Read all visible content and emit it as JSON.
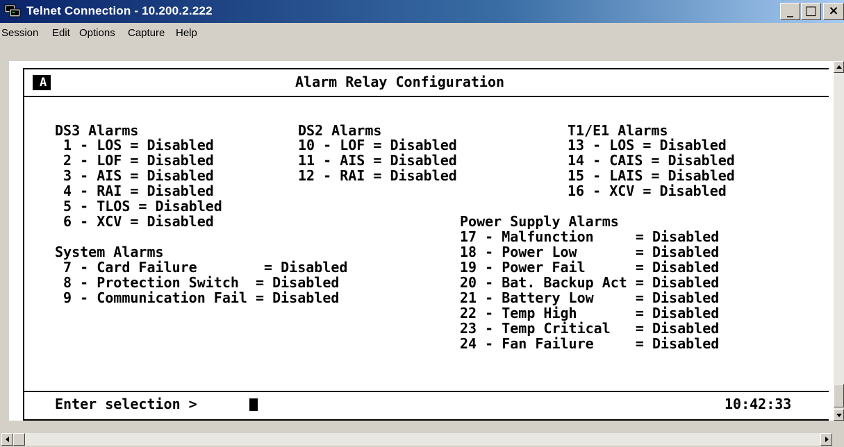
{
  "window": {
    "title": "Telnet Connection - 10.200.2.222",
    "minimize_glyph": "_",
    "maximize_glyph": "□",
    "close_glyph": "×"
  },
  "menu": {
    "items": [
      "Session",
      "Edit",
      "Options",
      "Capture",
      "Help"
    ]
  },
  "screen": {
    "id": "A",
    "title": "Alarm Relay Configuration",
    "lines": [
      "DS3 Alarms",
      " 1 - LOS = Disabled",
      " 2 - LOF = Disabled",
      " 3 - AIS = Disabled",
      " 4 - RAI = Disabled",
      " 5 - TLOS = Disabled",
      " 6 - XCV = Disabled",
      "System Alarms",
      " 7 - Card Failure        = Disabled",
      " 8 - Protection Switch  = Disabled",
      " 9 - Communication Fail = Disabled",
      "DS2 Alarms",
      "10 - LOF = Disabled",
      "11 - AIS = Disabled",
      "12 - RAI = Disabled",
      "T1/E1 Alarms",
      "13 - LOS = Disabled",
      "14 - CAIS = Disabled",
      "15 - LAIS = Disabled",
      "16 - XCV = Disabled",
      "Power Supply Alarms",
      "17 - Malfunction     = Disabled",
      "18 - Power Low       = Disabled",
      "19 - Power Fail      = Disabled",
      "20 - Bat. Backup Act = Disabled",
      "21 - Battery Low     = Disabled",
      "22 - Temp High       = Disabled",
      "23 - Temp Critical   = Disabled",
      "24 - Fan Failure     = Disabled"
    ],
    "prompt": "Enter selection >",
    "clock": "10:42:33"
  },
  "icons": {
    "app": "telnet-terminal-icon"
  }
}
